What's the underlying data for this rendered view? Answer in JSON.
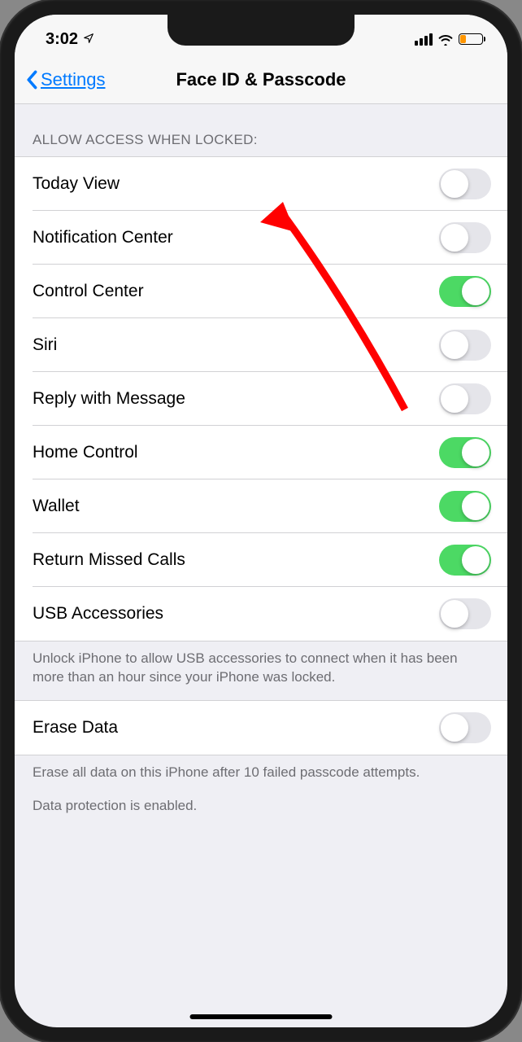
{
  "status": {
    "time": "3:02",
    "battery_level": "low"
  },
  "nav": {
    "back_label": "Settings",
    "title": "Face ID & Passcode"
  },
  "sections": {
    "allow_access": {
      "header": "ALLOW ACCESS WHEN LOCKED:",
      "rows": [
        {
          "label": "Today View",
          "on": false
        },
        {
          "label": "Notification Center",
          "on": false
        },
        {
          "label": "Control Center",
          "on": true
        },
        {
          "label": "Siri",
          "on": false
        },
        {
          "label": "Reply with Message",
          "on": false
        },
        {
          "label": "Home Control",
          "on": true
        },
        {
          "label": "Wallet",
          "on": true
        },
        {
          "label": "Return Missed Calls",
          "on": true
        },
        {
          "label": "USB Accessories",
          "on": false
        }
      ],
      "footer": "Unlock iPhone to allow USB accessories to connect when it has been more than an hour since your iPhone was locked."
    },
    "erase": {
      "rows": [
        {
          "label": "Erase Data",
          "on": false
        }
      ],
      "footer1": "Erase all data on this iPhone after 10 failed passcode attempts.",
      "footer2": "Data protection is enabled."
    }
  }
}
